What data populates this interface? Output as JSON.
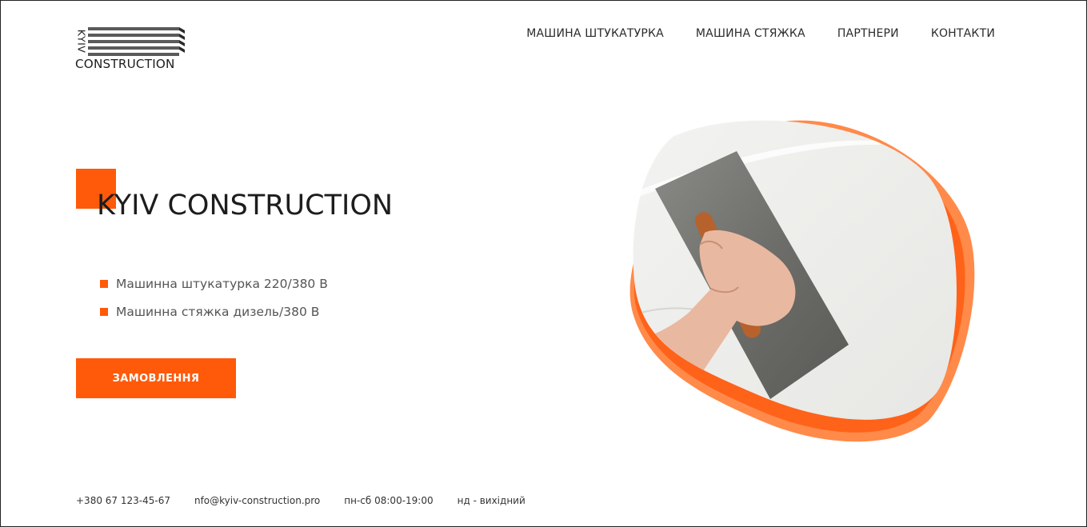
{
  "brand": {
    "logo_kyiv": "KYIV",
    "logo_construction": "CONSTRUCTION"
  },
  "nav": {
    "items": [
      {
        "label": "МАШИНА ШТУКАТУРКА"
      },
      {
        "label": "МАШИНА СТЯЖКА"
      },
      {
        "label": "ПАРТНЕРИ"
      },
      {
        "label": "КОНТАКТИ"
      }
    ]
  },
  "hero": {
    "title": "KYIV CONSTRUCTION",
    "features": [
      "Машинна штукатурка 220/380 В",
      "Машинна стяжка дизель/380 В"
    ],
    "order_button": "ЗАМОВЛЕННЯ",
    "image_icon": "plastering-trowel-illustration"
  },
  "footer": {
    "phone": "+380 67 123-45-67",
    "email": "nfo@kyiv-construction.pro",
    "hours_weekdays": "пн-сб 08:00-19:00",
    "hours_sunday": "нд - вихідний"
  },
  "colors": {
    "accent": "#ff5a0a",
    "text_dark": "#1d1d1d",
    "text_muted": "#555555",
    "background": "#ffffff"
  }
}
